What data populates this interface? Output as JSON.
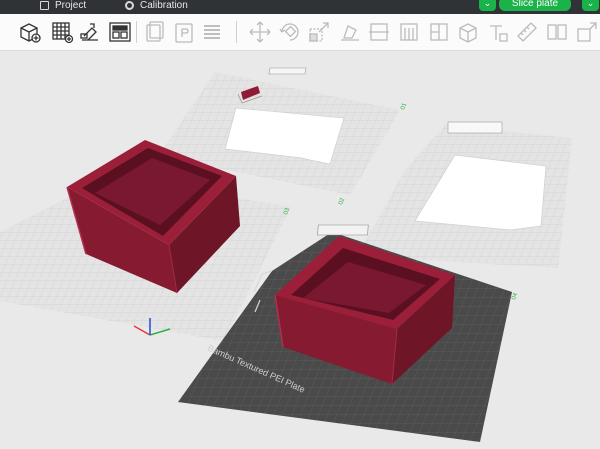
{
  "topbar": {
    "project_label": "Project",
    "calibration_label": "Calibration",
    "slice_label": "Slice plate",
    "dropdown_glyph": "⌄",
    "accent": "#19b34a"
  },
  "toolbar": {
    "icons": [
      "add-cube-icon",
      "grid-arrange-icon",
      "auto-orient-icon",
      "plate-layout-icon",
      "copy-plate-icon",
      "paste-plate-icon",
      "layers-icon",
      "move-icon",
      "rotate-icon",
      "scale-icon",
      "lay-on-face-icon",
      "cut-icon",
      "support-paint-icon",
      "seam-paint-icon",
      "color-paint-icon",
      "assembly-icon",
      "text-icon",
      "measure-icon",
      "split-icon"
    ]
  },
  "viewport": {
    "plate_label": "Bambu Textured PEI Plate",
    "model_color": "#8f1b34",
    "plate_numbers": [
      "01",
      "02",
      "03",
      "04"
    ]
  }
}
